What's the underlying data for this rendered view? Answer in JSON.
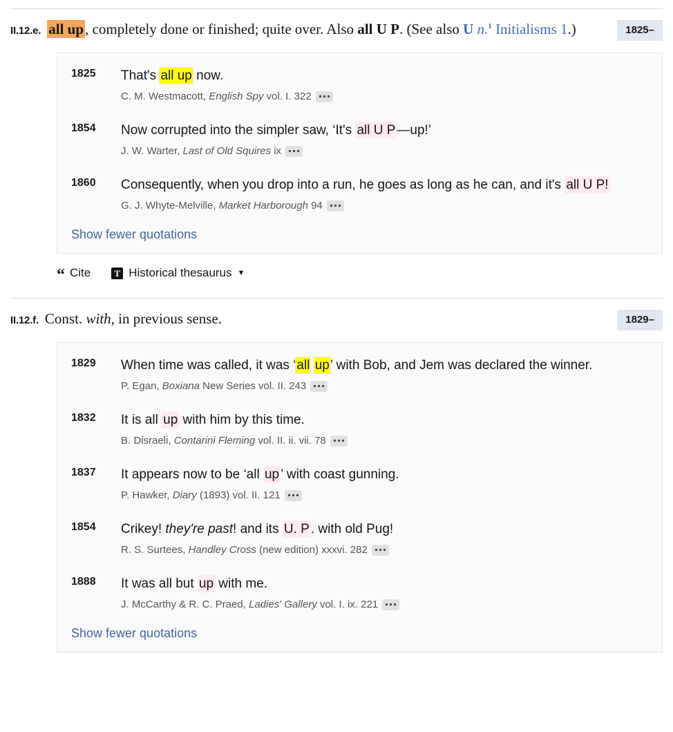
{
  "senses": [
    {
      "number": "II.12.e.",
      "date_badge": "1825–",
      "headword": "all up",
      "definition_part1": ", completely done or finished; quite over. Also ",
      "also_form": "all U P",
      "definition_part2": ". (See also ",
      "xref_1": "U",
      "xref_1_italic": "n.",
      "xref_1_sup": "1",
      "xref_2": "Initialisms 1",
      "definition_part3": ".)",
      "quotations": [
        {
          "date": "1825",
          "text_before": "That's ",
          "highlight": "all up",
          "highlight_style": "yellow",
          "text_after": " now.",
          "source_plain1": "C. M. Westmacott, ",
          "source_italic": "English Spy",
          "source_plain2": " vol. I. 322",
          "menu_icon": "ellipsis-icon"
        },
        {
          "date": "1854",
          "text_before": "Now corrupted into the simpler saw, ‘It's ",
          "highlight": "all U P",
          "highlight_style": "pink",
          "text_after": "—up!’",
          "source_plain1": "J. W. Warter, ",
          "source_italic": "Last of Old Squires",
          "source_plain2": " ix",
          "menu_icon": "ellipsis-icon"
        },
        {
          "date": "1860",
          "text_before": "Consequently, when you drop into a run, he goes as long as he can, and it's ",
          "highlight": "all U P!",
          "highlight_style": "pink",
          "text_after": "",
          "source_plain1": "G. J. Whyte-Melville, ",
          "source_italic": "Market Harborough",
          "source_plain2": " 94",
          "menu_icon": "ellipsis-icon"
        }
      ],
      "show_fewer_label": "Show fewer quotations",
      "tools": {
        "cite_label": "Cite",
        "cite_icon": "quote-mark-icon",
        "thesaurus_label": "Historical thesaurus",
        "thesaurus_icon": "thesaurus-t-icon",
        "thesaurus_caret": "▼"
      }
    },
    {
      "number": "II.12.f.",
      "date_badge": "1829–",
      "definition_plain1": "Const. ",
      "definition_italic": "with",
      "definition_plain2": ", in previous sense.",
      "quotations": [
        {
          "date": "1829",
          "text_before": "When time was called, it was ‘",
          "highlight": "all",
          "highlight2": "up",
          "highlight_style": "yellow",
          "text_after": "’ with Bob, and Jem was declared the winner.",
          "source_plain1": "P. Egan, ",
          "source_italic": "Boxiana",
          "source_plain2": " New Series vol. II. 243",
          "menu_icon": "ellipsis-icon"
        },
        {
          "date": "1832",
          "text_before": "It is all ",
          "highlight": "up",
          "highlight_style": "pink",
          "text_after": " with him by this time.",
          "source_plain1": "B. Disraeli, ",
          "source_italic": "Contarini Fleming",
          "source_plain2": " vol. II. ii. vii. 78",
          "menu_icon": "ellipsis-icon"
        },
        {
          "date": "1837",
          "text_before": "It appears now to be ‘all ",
          "highlight": "up",
          "highlight_style": "pink",
          "text_after": "’ with coast gunning.",
          "source_plain1": "P. Hawker, ",
          "source_italic": "Diary",
          "source_plain2": " (1893) vol. II. 121",
          "menu_icon": "ellipsis-icon"
        },
        {
          "date": "1854",
          "text_before": "Crikey! ",
          "text_italic": "they're past",
          "text_mid": "! and its ",
          "highlight": "U. P",
          "highlight_style": "pink",
          "text_after": ". with old Pug!",
          "source_plain1": "R. S. Surtees, ",
          "source_italic": "Handley Cross",
          "source_plain2": " (new edition) xxxvi. 282",
          "menu_icon": "ellipsis-icon"
        },
        {
          "date": "1888",
          "text_before": "It was all but ",
          "highlight": "up",
          "highlight_style": "pink",
          "text_after": " with me.",
          "source_plain1": "J. McCarthy & R. C. Praed, ",
          "source_italic": "Ladies' Gallery",
          "source_plain2": " vol. I. ix. 221",
          "menu_icon": "ellipsis-icon"
        }
      ],
      "show_fewer_label": "Show fewer quotations"
    }
  ],
  "colors": {
    "highlight_orange": "#f5a55a",
    "highlight_yellow": "#ffff00",
    "highlight_pink": "#fdeaee",
    "link_blue": "#44669e",
    "xref_blue": "#3f6cb4",
    "date_badge_bg": "#e2e6ef",
    "block_bg": "#fafafa",
    "divider": "#d6dce8"
  }
}
